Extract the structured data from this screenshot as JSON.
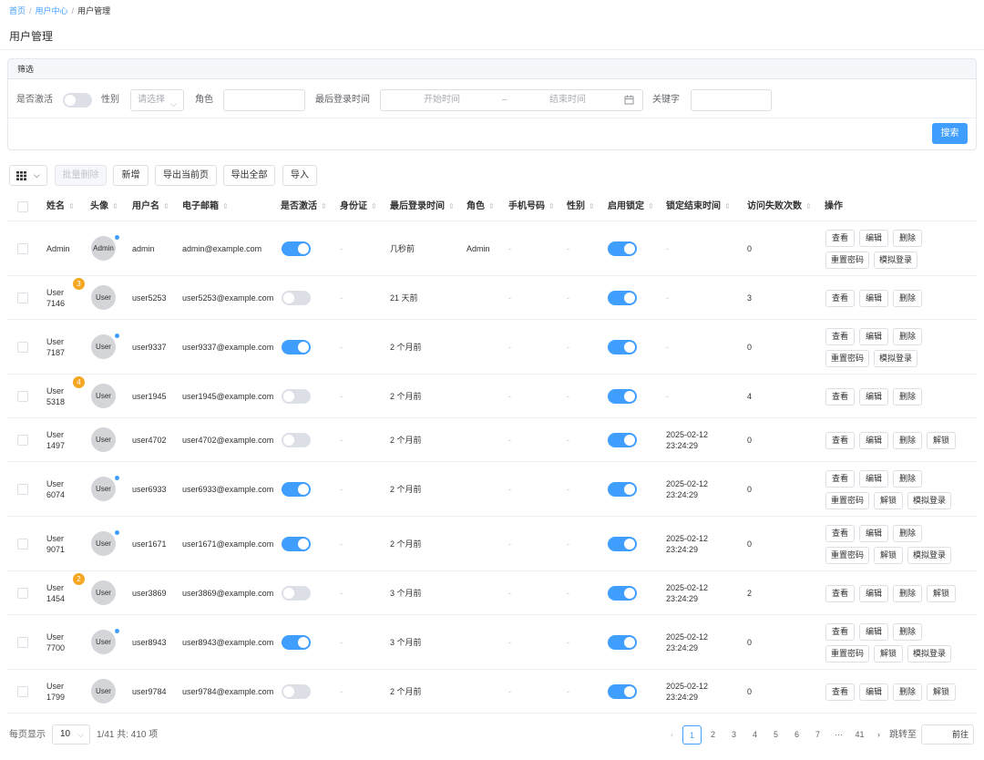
{
  "breadcrumb": {
    "home": "首页",
    "center": "用户中心",
    "current": "用户管理",
    "sep": "/"
  },
  "page_title": "用户管理",
  "filter": {
    "title": "筛选",
    "active_label": "是否激活",
    "gender_label": "性别",
    "gender_placeholder": "请选择",
    "role_label": "角色",
    "last_login_label": "最后登录时间",
    "start_placeholder": "开始时间",
    "range_sep": "–",
    "end_placeholder": "结束时间",
    "keyword_label": "关键字",
    "search_button": "搜索"
  },
  "toolbar": {
    "batch_delete": "批量删除",
    "add": "新增",
    "export_page": "导出当前页",
    "export_all": "导出全部",
    "import": "导入"
  },
  "columns": {
    "name": "姓名",
    "avatar": "头像",
    "username": "用户名",
    "email": "电子邮箱",
    "active": "是否激活",
    "id_card": "身份证",
    "last_login": "最后登录时间",
    "role": "角色",
    "phone": "手机号码",
    "gender": "性别",
    "lock": "启用锁定",
    "lock_end": "锁定结束时间",
    "fail_count": "访问失败次数",
    "actions": "操作"
  },
  "dash": "-",
  "action_labels": {
    "view": "查看",
    "edit": "编辑",
    "delete": "删除",
    "reset_pwd": "重置密码",
    "impersonate": "模拟登录",
    "unlock": "解锁"
  },
  "rows": [
    {
      "name1": "Admin",
      "name2": "",
      "badge": "",
      "avatar": "Admin",
      "dot": true,
      "username": "admin",
      "email": "admin@example.com",
      "active": true,
      "last_login": "几秒前",
      "role": "Admin",
      "lock": true,
      "lock_end1": "",
      "lock_end2": "",
      "fail": "0",
      "actions": [
        [
          "view",
          "edit",
          "delete"
        ],
        [
          "reset_pwd",
          "impersonate"
        ]
      ]
    },
    {
      "name1": "User",
      "name2": "7146",
      "badge": "3",
      "avatar": "User",
      "dot": false,
      "username": "user5253",
      "email": "user5253@example.com",
      "active": false,
      "last_login": "21 天前",
      "role": "",
      "lock": true,
      "lock_end1": "",
      "lock_end2": "",
      "fail": "3",
      "actions": [
        [
          "view",
          "edit",
          "delete"
        ]
      ]
    },
    {
      "name1": "User",
      "name2": "7187",
      "badge": "",
      "avatar": "User",
      "dot": true,
      "username": "user9337",
      "email": "user9337@example.com",
      "active": true,
      "last_login": "2 个月前",
      "role": "",
      "lock": true,
      "lock_end1": "",
      "lock_end2": "",
      "fail": "0",
      "actions": [
        [
          "view",
          "edit",
          "delete"
        ],
        [
          "reset_pwd",
          "impersonate"
        ]
      ]
    },
    {
      "name1": "User",
      "name2": "5318",
      "badge": "4",
      "avatar": "User",
      "dot": false,
      "username": "user1945",
      "email": "user1945@example.com",
      "active": false,
      "last_login": "2 个月前",
      "role": "",
      "lock": true,
      "lock_end1": "",
      "lock_end2": "",
      "fail": "4",
      "actions": [
        [
          "view",
          "edit",
          "delete"
        ]
      ]
    },
    {
      "name1": "User",
      "name2": "1497",
      "badge": "",
      "avatar": "User",
      "dot": false,
      "username": "user4702",
      "email": "user4702@example.com",
      "active": false,
      "last_login": "2 个月前",
      "role": "",
      "lock": true,
      "lock_end1": "2025-02-12",
      "lock_end2": "23:24:29",
      "fail": "0",
      "actions": [
        [
          "view",
          "edit",
          "delete",
          "unlock"
        ]
      ]
    },
    {
      "name1": "User",
      "name2": "6074",
      "badge": "",
      "avatar": "User",
      "dot": true,
      "username": "user6933",
      "email": "user6933@example.com",
      "active": true,
      "last_login": "2 个月前",
      "role": "",
      "lock": true,
      "lock_end1": "2025-02-12",
      "lock_end2": "23:24:29",
      "fail": "0",
      "actions": [
        [
          "view",
          "edit",
          "delete"
        ],
        [
          "reset_pwd",
          "unlock",
          "impersonate"
        ]
      ]
    },
    {
      "name1": "User",
      "name2": "9071",
      "badge": "",
      "avatar": "User",
      "dot": true,
      "username": "user1671",
      "email": "user1671@example.com",
      "active": true,
      "last_login": "2 个月前",
      "role": "",
      "lock": true,
      "lock_end1": "2025-02-12",
      "lock_end2": "23:24:29",
      "fail": "0",
      "actions": [
        [
          "view",
          "edit",
          "delete"
        ],
        [
          "reset_pwd",
          "unlock",
          "impersonate"
        ]
      ]
    },
    {
      "name1": "User",
      "name2": "1454",
      "badge": "2",
      "avatar": "User",
      "dot": false,
      "username": "user3869",
      "email": "user3869@example.com",
      "active": false,
      "last_login": "3 个月前",
      "role": "",
      "lock": true,
      "lock_end1": "2025-02-12",
      "lock_end2": "23:24:29",
      "fail": "2",
      "actions": [
        [
          "view",
          "edit",
          "delete",
          "unlock"
        ]
      ]
    },
    {
      "name1": "User",
      "name2": "7700",
      "badge": "",
      "avatar": "User",
      "dot": true,
      "username": "user8943",
      "email": "user8943@example.com",
      "active": true,
      "last_login": "3 个月前",
      "role": "",
      "lock": true,
      "lock_end1": "2025-02-12",
      "lock_end2": "23:24:29",
      "fail": "0",
      "actions": [
        [
          "view",
          "edit",
          "delete"
        ],
        [
          "reset_pwd",
          "unlock",
          "impersonate"
        ]
      ]
    },
    {
      "name1": "User",
      "name2": "1799",
      "badge": "",
      "avatar": "User",
      "dot": false,
      "username": "user9784",
      "email": "user9784@example.com",
      "active": false,
      "last_login": "2 个月前",
      "role": "",
      "lock": true,
      "lock_end1": "2025-02-12",
      "lock_end2": "23:24:29",
      "fail": "0",
      "actions": [
        [
          "view",
          "edit",
          "delete",
          "unlock"
        ]
      ]
    }
  ],
  "pagination": {
    "per_page_label": "每页显示",
    "per_page": "10",
    "summary": "1/41 共: 410 项",
    "pages": [
      "1",
      "2",
      "3",
      "4",
      "5",
      "6",
      "7",
      "···",
      "41"
    ],
    "current": "1",
    "jump_label": "跳转至",
    "go": "前往",
    "prev": "‹",
    "next": "›"
  },
  "colors": {
    "primary": "#409eff",
    "badge": "#f5a623",
    "switch_off": "#dcdfe6"
  }
}
